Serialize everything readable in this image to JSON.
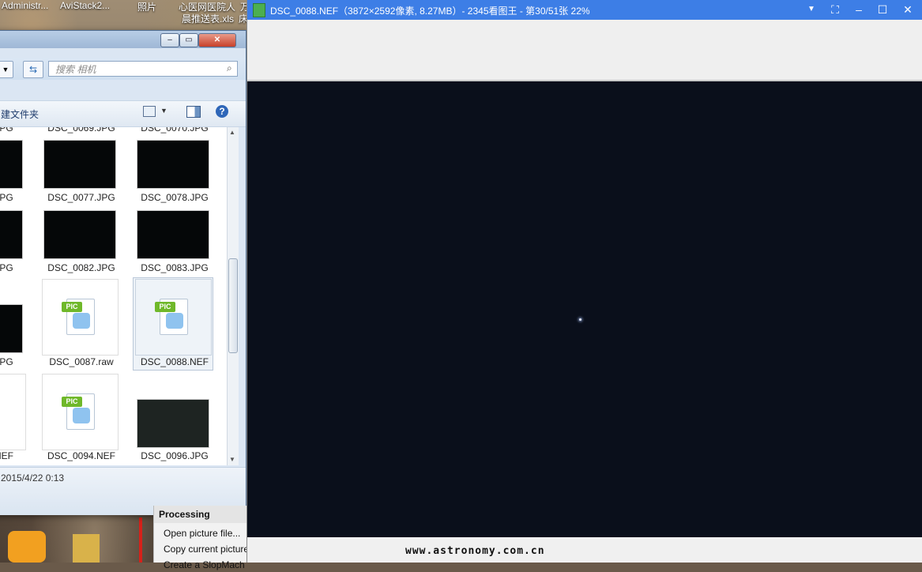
{
  "taskbar_icons": [
    "Administr...",
    "AviStack2...",
    "照片",
    "心医网医院人",
    "万"
  ],
  "desktop_file": "晨推送表.xls",
  "desktop_file_tail": "床",
  "explorer": {
    "search_placeholder": "搜索 相机",
    "toolbar_new_folder": "建文件夹",
    "row0": [
      "JPG",
      "DSC_0069.JPG",
      "DSC_0070.JPG"
    ],
    "row1": [
      "JPG",
      "DSC_0077.JPG",
      "DSC_0078.JPG"
    ],
    "row2": [
      "JPG",
      "DSC_0082.JPG",
      "DSC_0083.JPG"
    ],
    "row3": [
      "JPG",
      "DSC_0087.raw",
      "DSC_0088.NEF"
    ],
    "row4": [
      "NEF",
      "DSC_0094.NEF",
      "DSC_0096.JPG"
    ],
    "pic_label": "PIC",
    "detail_date": "2015/4/22 0:13"
  },
  "processing": {
    "header": "Processing",
    "items": [
      "Open picture file...",
      "Copy current picture t",
      "Create a SlopMach"
    ]
  },
  "viewer": {
    "title": "DSC_0088.NEF（3872×2592像素, 8.27MB）- 2345看图王 - 第30/51张 22%",
    "watermark": "www.astronomy.com.cn",
    "title_bg": "#3d7ee6",
    "image_bg": "#0a0f1b"
  }
}
